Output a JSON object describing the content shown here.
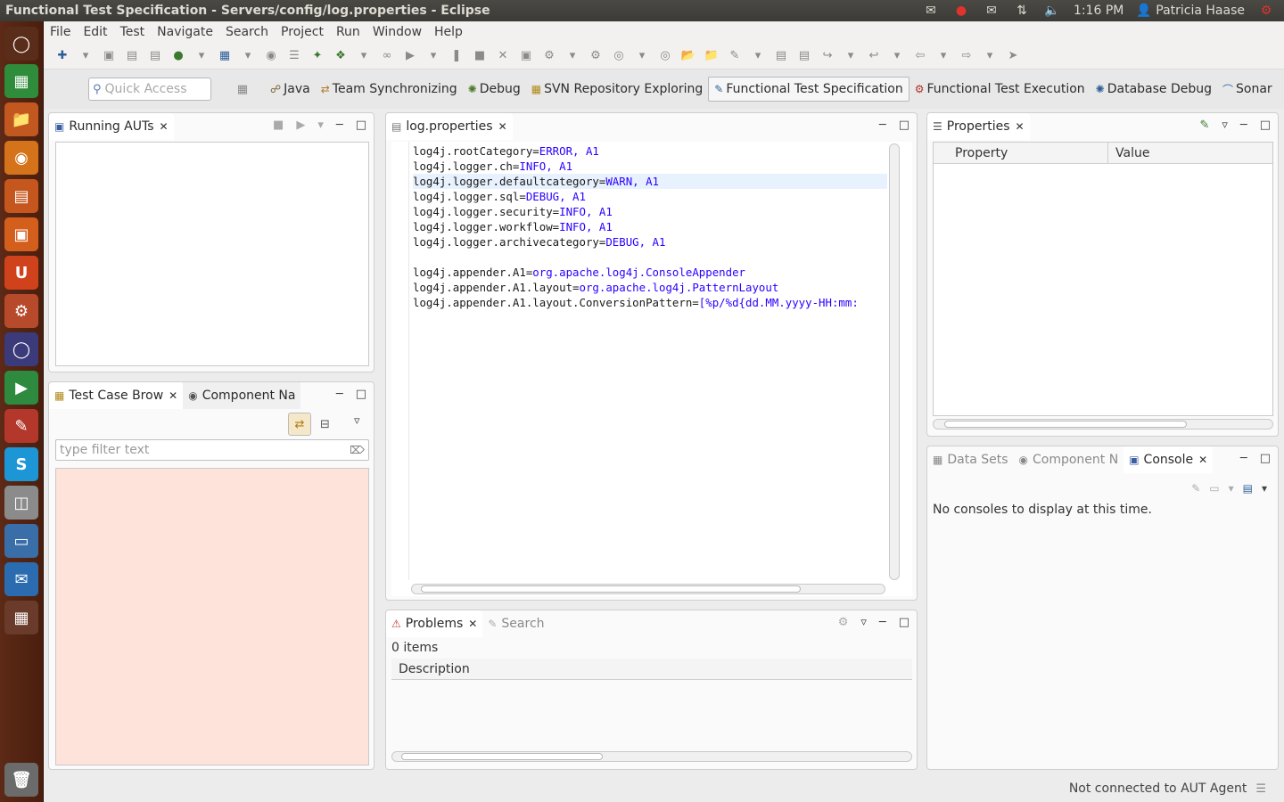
{
  "window": {
    "title": "Functional Test Specification - Servers/config/log.properties - Eclipse",
    "clock": "1:16 PM",
    "user": "Patricia Haase"
  },
  "menu": [
    "File",
    "Edit",
    "Test",
    "Navigate",
    "Search",
    "Project",
    "Run",
    "Window",
    "Help"
  ],
  "quick_access": {
    "placeholder": "Quick Access"
  },
  "perspectives": [
    {
      "label": "Java",
      "icon": "java-perspective-icon",
      "active": false
    },
    {
      "label": "Team Synchronizing",
      "icon": "team-sync-icon",
      "active": false
    },
    {
      "label": "Debug",
      "icon": "debug-icon",
      "active": false
    },
    {
      "label": "SVN Repository Exploring",
      "icon": "svn-icon",
      "active": false
    },
    {
      "label": "Functional Test Specification",
      "icon": "spec-icon",
      "active": true
    },
    {
      "label": "Functional Test Execution",
      "icon": "execution-icon",
      "active": false
    },
    {
      "label": "Database Debug",
      "icon": "db-debug-icon",
      "active": false
    },
    {
      "label": "Sonar",
      "icon": "sonar-icon",
      "active": false
    }
  ],
  "running_auts": {
    "tab": "Running AUTs"
  },
  "test_case_browser": {
    "tab": "Test Case Brow",
    "tab2": "Component Na",
    "filter_placeholder": "type filter text"
  },
  "editor": {
    "tab": "log.properties",
    "lines": [
      {
        "key": "log4j.rootCategory=",
        "value": "ERROR, A1"
      },
      {
        "key": "log4j.logger.ch=",
        "value": "INFO, A1"
      },
      {
        "key": "log4j.logger.defaultcategory=",
        "value": "WARN, A1"
      },
      {
        "key": "log4j.logger.sql=",
        "value": "DEBUG, A1"
      },
      {
        "key": "log4j.logger.security=",
        "value": "INFO, A1"
      },
      {
        "key": "log4j.logger.workflow=",
        "value": "INFO, A1"
      },
      {
        "key": "log4j.logger.archivecategory=",
        "value": "DEBUG, A1"
      },
      {
        "key": "",
        "value": ""
      },
      {
        "key": "log4j.appender.A1=",
        "value": "org.apache.log4j.ConsoleAppender"
      },
      {
        "key": "log4j.appender.A1.layout=",
        "value": "org.apache.log4j.PatternLayout"
      },
      {
        "key": "log4j.appender.A1.layout.ConversionPattern=",
        "value": "[%p/%d{dd.MM.yyyy-HH:mm:"
      }
    ]
  },
  "problems": {
    "tab": "Problems",
    "tab2": "Search",
    "count": "0 items",
    "column": "Description"
  },
  "properties": {
    "tab": "Properties",
    "col_property": "Property",
    "col_value": "Value"
  },
  "console": {
    "tab1": "Data Sets",
    "tab2": "Component N",
    "tab3": "Console",
    "message": "No consoles to display at this time."
  },
  "status": {
    "text": "Not connected to AUT Agent"
  }
}
